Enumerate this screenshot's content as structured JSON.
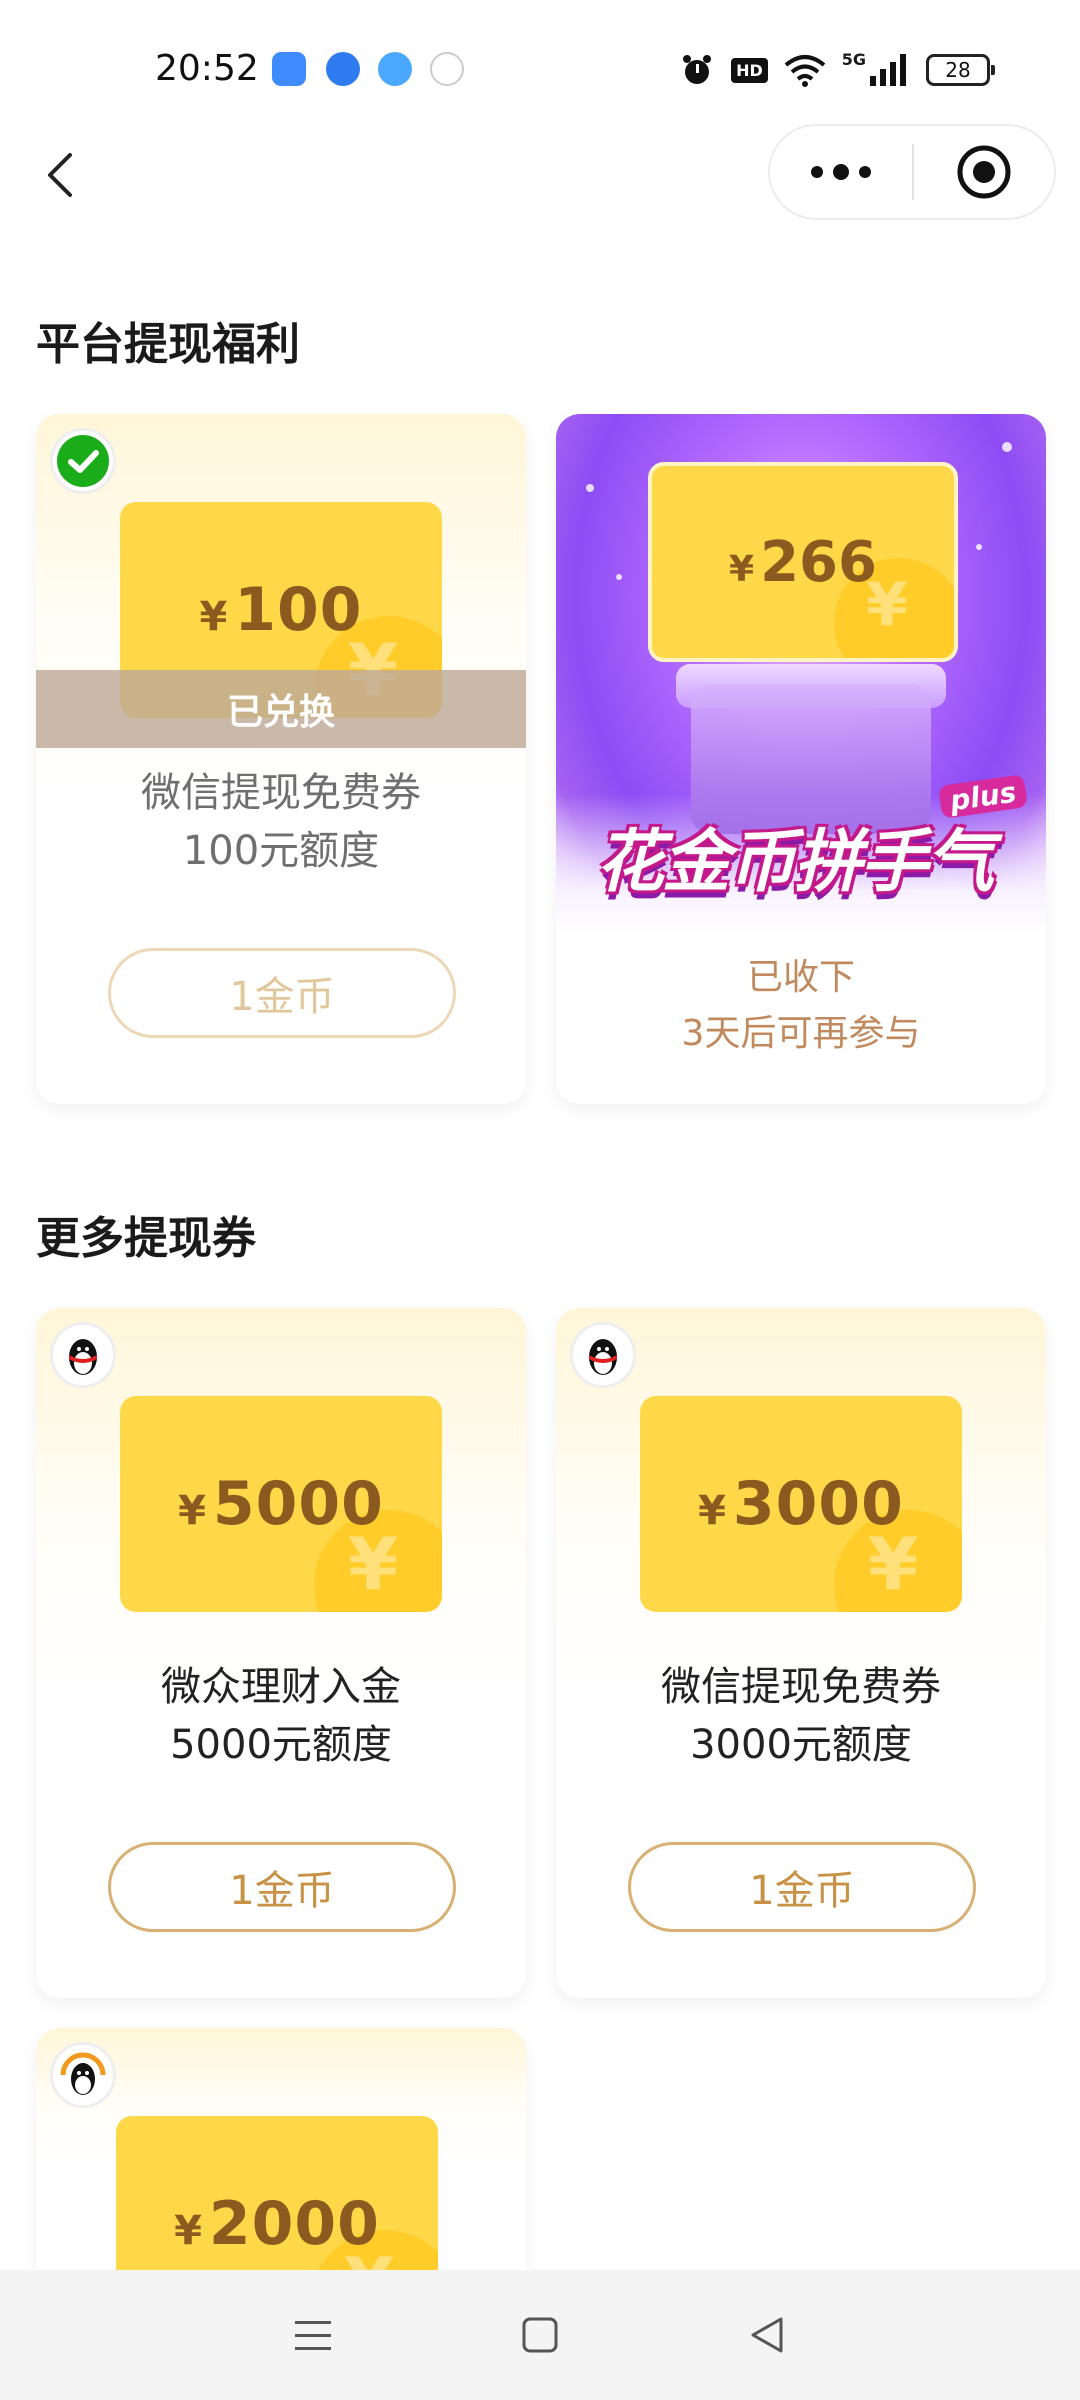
{
  "status_bar": {
    "time": "20:52",
    "network": "5G",
    "hd_badge": "HD",
    "battery": "28"
  },
  "header": {
    "back_icon": "chevron-left-icon",
    "more_icon": "more-dots-icon",
    "close_icon": "target-icon"
  },
  "sections": {
    "platform_title": "平台提现福利",
    "more_title": "更多提现券"
  },
  "cards": [
    {
      "currency": "¥",
      "amount": "100",
      "badge": "已兑换",
      "title_line1": "微信提现免费券",
      "title_line2": "100元额度",
      "button": "1金币",
      "logo": "wechat-pay-icon"
    },
    {
      "currency": "¥",
      "amount": "5000",
      "title_line1": "微众理财入金",
      "title_line2": "5000元额度",
      "button": "1金币",
      "logo": "qq-penguin-icon"
    },
    {
      "currency": "¥",
      "amount": "3000",
      "title_line1": "微信提现免费券",
      "title_line2": "3000元额度",
      "button": "1金币",
      "logo": "qq-penguin-icon"
    },
    {
      "currency": "¥",
      "amount": "2000",
      "logo": "penguin-headset-icon"
    }
  ],
  "promo": {
    "currency": "¥",
    "amount": "266",
    "logo_text": "花金币拼手气",
    "plus_badge": "plus",
    "status_line1": "已收下",
    "status_line2": "3天后可再参与"
  },
  "bottom_nav": {
    "menu_icon": "menu-icon",
    "home_icon": "square-home-icon",
    "back_icon": "triangle-back-icon"
  },
  "colors": {
    "voucher_gold": "#ffd84a",
    "button_border": "#d9b074",
    "button_text": "#c79245",
    "promo_purple": "#8d4cf4"
  }
}
